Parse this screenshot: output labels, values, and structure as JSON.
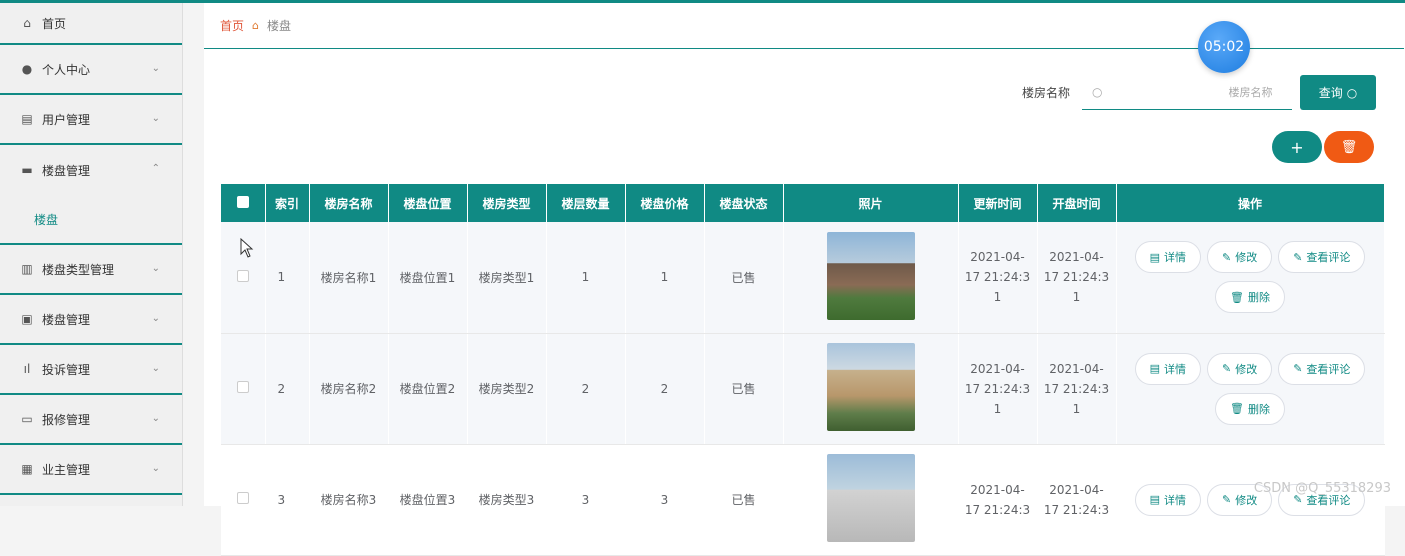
{
  "sidebar": {
    "items": [
      {
        "label": "首页",
        "icon": "home-icon",
        "glyph": "⌂"
      },
      {
        "label": "个人中心",
        "icon": "user-icon",
        "glyph": "●",
        "arrow": "⌄"
      },
      {
        "label": "用户管理",
        "icon": "clipboard-icon",
        "glyph": "▤",
        "arrow": "⌄"
      },
      {
        "label": "楼盘管理",
        "icon": "briefcase-icon",
        "glyph": "▬",
        "arrow": "⌃"
      },
      {
        "label": "楼盘类型管理",
        "icon": "bar-chart-icon",
        "glyph": "▥",
        "arrow": "⌄"
      },
      {
        "label": "楼盘管理",
        "icon": "checklist-icon",
        "glyph": "▣",
        "arrow": "⌄"
      },
      {
        "label": "投诉管理",
        "icon": "stats-icon",
        "glyph": "ıl",
        "arrow": "⌄"
      },
      {
        "label": "报修管理",
        "icon": "message-icon",
        "glyph": "▭",
        "arrow": "⌄"
      },
      {
        "label": "业主管理",
        "icon": "grid-icon",
        "glyph": "▦",
        "arrow": "⌄"
      }
    ],
    "submenu_label": "楼盘"
  },
  "breadcrumb": {
    "home": "首页",
    "current": "楼盘"
  },
  "timer": "05:02",
  "search": {
    "label": "楼房名称",
    "placeholder": "楼房名称",
    "button": "查询"
  },
  "buttons": {
    "add": "+",
    "delete": "🗑"
  },
  "table": {
    "headers": [
      "索引",
      "楼房名称",
      "楼盘位置",
      "楼房类型",
      "楼层数量",
      "楼盘价格",
      "楼盘状态",
      "照片",
      "更新时间",
      "开盘时间",
      "操作"
    ],
    "ops": {
      "detail": "详情",
      "edit": "修改",
      "reviews": "查看评论",
      "delete": "删除"
    },
    "rows": [
      {
        "index": "1",
        "name": "楼房名称1",
        "location": "楼盘位置1",
        "type": "楼房类型1",
        "floors": "1",
        "price": "1",
        "status": "已售",
        "update_l1": "2021-04-",
        "update_l2": "17 21:24:3",
        "update_l3": "1",
        "open_l1": "2021-04-",
        "open_l2": "17 21:24:3",
        "open_l3": "1"
      },
      {
        "index": "2",
        "name": "楼房名称2",
        "location": "楼盘位置2",
        "type": "楼房类型2",
        "floors": "2",
        "price": "2",
        "status": "已售",
        "update_l1": "2021-04-",
        "update_l2": "17 21:24:3",
        "update_l3": "1",
        "open_l1": "2021-04-",
        "open_l2": "17 21:24:3",
        "open_l3": "1"
      },
      {
        "index": "3",
        "name": "楼房名称3",
        "location": "楼盘位置3",
        "type": "楼房类型3",
        "floors": "3",
        "price": "3",
        "status": "已售",
        "update_l1": "2021-04-",
        "update_l2": "17 21:24:3",
        "update_l3": "",
        "open_l1": "2021-04-",
        "open_l2": "17 21:24:3",
        "open_l3": ""
      }
    ]
  },
  "watermark": "CSDN @Q_55318293"
}
